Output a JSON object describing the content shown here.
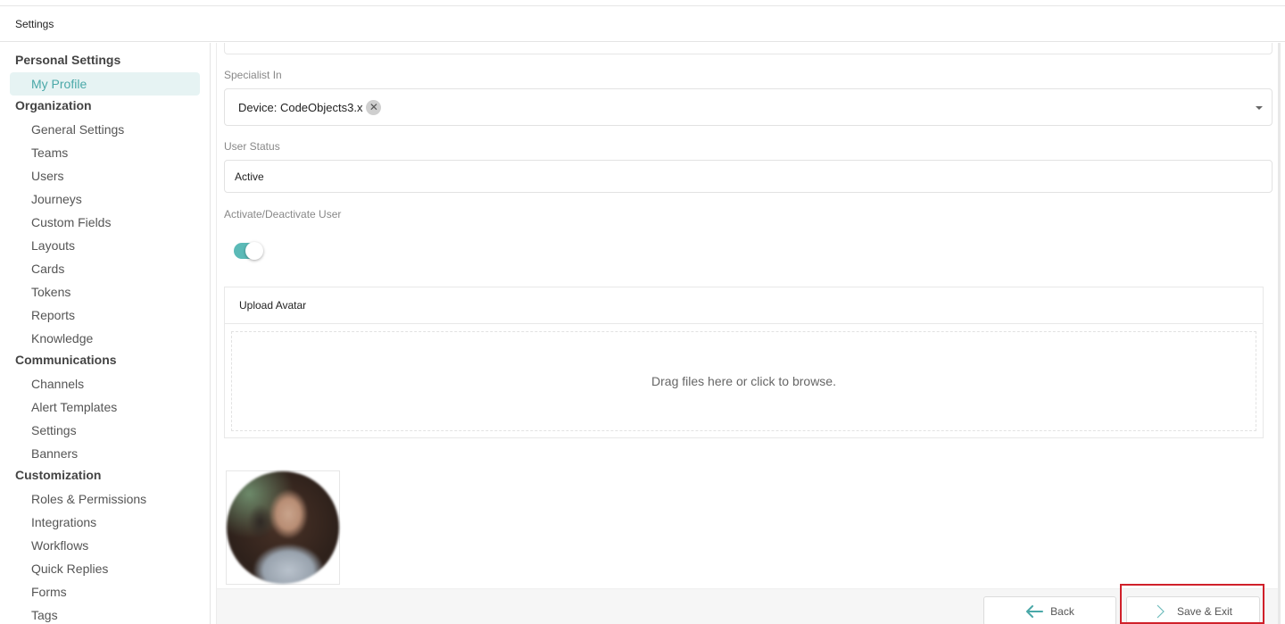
{
  "window": {
    "title": "Settings"
  },
  "sidebar": {
    "sections": [
      {
        "title": "Personal Settings",
        "items": [
          {
            "label": "My Profile",
            "active": true
          }
        ]
      },
      {
        "title": "Organization",
        "items": [
          {
            "label": "General Settings"
          },
          {
            "label": "Teams"
          },
          {
            "label": "Users"
          },
          {
            "label": "Journeys"
          },
          {
            "label": "Custom Fields"
          },
          {
            "label": "Layouts"
          },
          {
            "label": "Cards"
          },
          {
            "label": "Tokens"
          },
          {
            "label": "Reports"
          },
          {
            "label": "Knowledge"
          }
        ]
      },
      {
        "title": "Communications",
        "items": [
          {
            "label": "Channels"
          },
          {
            "label": "Alert Templates"
          },
          {
            "label": "Settings"
          },
          {
            "label": "Banners"
          }
        ]
      },
      {
        "title": "Customization",
        "items": [
          {
            "label": "Roles & Permissions"
          },
          {
            "label": "Integrations"
          },
          {
            "label": "Workflows"
          },
          {
            "label": "Quick Replies"
          },
          {
            "label": "Forms"
          },
          {
            "label": "Tags"
          }
        ]
      }
    ]
  },
  "form": {
    "specialist_in": {
      "label": "Specialist In",
      "chips": [
        "Device: CodeObjects3.x"
      ],
      "remove_icon": "close-icon",
      "dropdown_icon": "caret-down-icon"
    },
    "user_status": {
      "label": "User Status",
      "value": "Active"
    },
    "activate": {
      "label": "Activate/Deactivate User",
      "on": true,
      "accent": "#5bbab7"
    },
    "upload_avatar": {
      "title": "Upload Avatar",
      "dropzone_text": "Drag files here or click to browse."
    }
  },
  "footer": {
    "back_label": "Back",
    "back_icon": "arrow-left-icon",
    "save_label": "Save & Exit",
    "save_icon": "chevron-right-icon",
    "highlight_color": "#d0202a"
  }
}
